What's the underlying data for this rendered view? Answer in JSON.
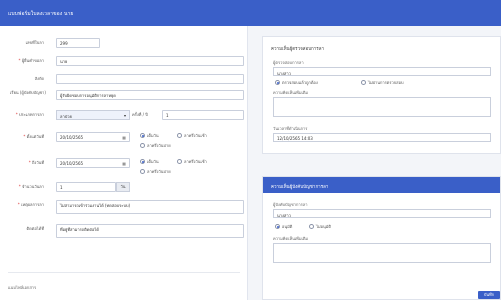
{
  "header": {
    "title": "แบบฟอร์มใบลงเวลาของ นาย"
  },
  "form": {
    "doc_no": {
      "label": "เลขที่ใบลา",
      "value": "299"
    },
    "requester": {
      "label": "ผู้ยื่นคำขอลา",
      "value": "นาย"
    },
    "position": {
      "label": "สังกัด",
      "value": ""
    },
    "to": {
      "label": "เรียน (ผู้บังคับบัญชา)",
      "value": "ผู้รับผิดชอบการอนุมัติการลาหยุด"
    },
    "leave_type": {
      "label": "ประเภทการลา",
      "value": "ลาป่วย",
      "count_label": "ครั้งที่ / ปี",
      "count_value": "1"
    },
    "start_date": {
      "label": "ตั้งแต่วันที่",
      "value": "20/10/2565",
      "opt_full": "เต็มวัน",
      "opt_morning": "ลาครึ่งวันเช้า",
      "opt_afternoon": "ลาครึ่งวันบ่าย"
    },
    "end_date": {
      "label": "ถึงวันที่",
      "value": "20/10/2565",
      "opt_full": "เต็มวัน",
      "opt_morning": "ลาครึ่งวันเช้า",
      "opt_afternoon": "ลาครึ่งวันบ่าย"
    },
    "total": {
      "label": "จำนวนวันลา",
      "value": "1",
      "unit": "วัน"
    },
    "reason": {
      "label": "เหตุผลการลา",
      "value": "ไม่สามารถเข้าร่วมงานได้ (ทดสอบระบบ)"
    },
    "contact": {
      "label": "ติดต่อได้ที่",
      "value": "ที่อยู่ที่สามารถติดต่อได้"
    },
    "footer_label": "แนบไฟล์เอกสาร"
  },
  "card1": {
    "title": "ความเห็นผู้ตรวจสอบการลา",
    "name_label": "ผู้ตรวจสอบการลา",
    "name_value": "นางสาว",
    "opt_ok": "ตรวจสอบแล้วถูกต้อง",
    "opt_no": "ไม่ผ่านการตรวจสอบ",
    "comment_label": "ความคิดเห็นเพิ่มเติม",
    "date_label": "วันเวลาที่ดำเนินการ",
    "date_value": "12/10/2565 14:03"
  },
  "card2": {
    "title": "ความเห็นผู้บังคับบัญชาการลา",
    "name_label": "ผู้บังคับบัญชาการลา",
    "name_value": "นางสาว",
    "opt_ok": "อนุมัติ",
    "opt_no": "ไม่อนุมัติ",
    "comment_label": "ความคิดเห็นเพิ่มเติม",
    "submit": "บันทึก"
  },
  "colors": {
    "accent": "#3a5fc8"
  }
}
